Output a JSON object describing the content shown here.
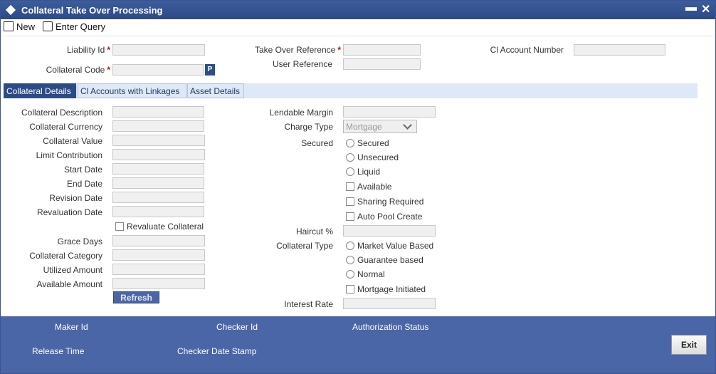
{
  "window": {
    "title": "Collateral Take Over Processing",
    "minimize_glyph": "▬",
    "close_glyph": "✕"
  },
  "toolbar": {
    "new_label": "New",
    "enter_query_label": "Enter Query"
  },
  "header_fields": {
    "liability_id": "Liability Id",
    "collateral_code": "Collateral Code",
    "take_over_reference": "Take Over Reference",
    "user_reference": "User Reference",
    "cl_account_number": "Cl Account Number",
    "p_button": "P",
    "required_mark": "*"
  },
  "tabs": {
    "collateral_details": "Collateral Details",
    "cl_accounts": "Cl Accounts with Linkages",
    "asset_details": "Asset Details"
  },
  "left_fields": {
    "collateral_description": "Collateral Description",
    "collateral_currency": "Collateral Currency",
    "collateral_value": "Collateral Value",
    "limit_contribution": "Limit Contribution",
    "start_date": "Start Date",
    "end_date": "End Date",
    "revision_date": "Revision Date",
    "revaluation_date": "Revaluation Date",
    "revaluate_collateral": "Revaluate Collateral",
    "grace_days": "Grace Days",
    "collateral_category": "Collateral Category",
    "utilized_amount": "Utilized Amount",
    "available_amount": "Available Amount",
    "refresh": "Refresh"
  },
  "right_fields": {
    "lendable_margin": "Lendable Margin",
    "charge_type": "Charge Type",
    "charge_type_value": "Mortgage",
    "secured": "Secured",
    "opt_secured": "Secured",
    "opt_unsecured": "Unsecured",
    "opt_liquid": "Liquid",
    "available": "Available",
    "sharing_required": "Sharing Required",
    "auto_pool_create": "Auto Pool Create",
    "haircut": "Haircut %",
    "collateral_type": "Collateral Type",
    "opt_market_value": "Market Value Based",
    "opt_guarantee": "Guarantee based",
    "opt_normal": "Normal",
    "mortgage_initiated": "Mortgage Initiated",
    "interest_rate": "Interest Rate"
  },
  "footer": {
    "maker_id": "Maker Id",
    "checker_id": "Checker Id",
    "authorization_status": "Authorization Status",
    "release_time": "Release Time",
    "checker_date_stamp": "Checker Date Stamp",
    "exit": "Exit"
  },
  "colors": {
    "title_bar": "#2c4a86",
    "footer": "#4a66a6",
    "tab_active": "#2c4a86",
    "tab_inactive": "#dfe8f6",
    "required": "#cc0000"
  }
}
